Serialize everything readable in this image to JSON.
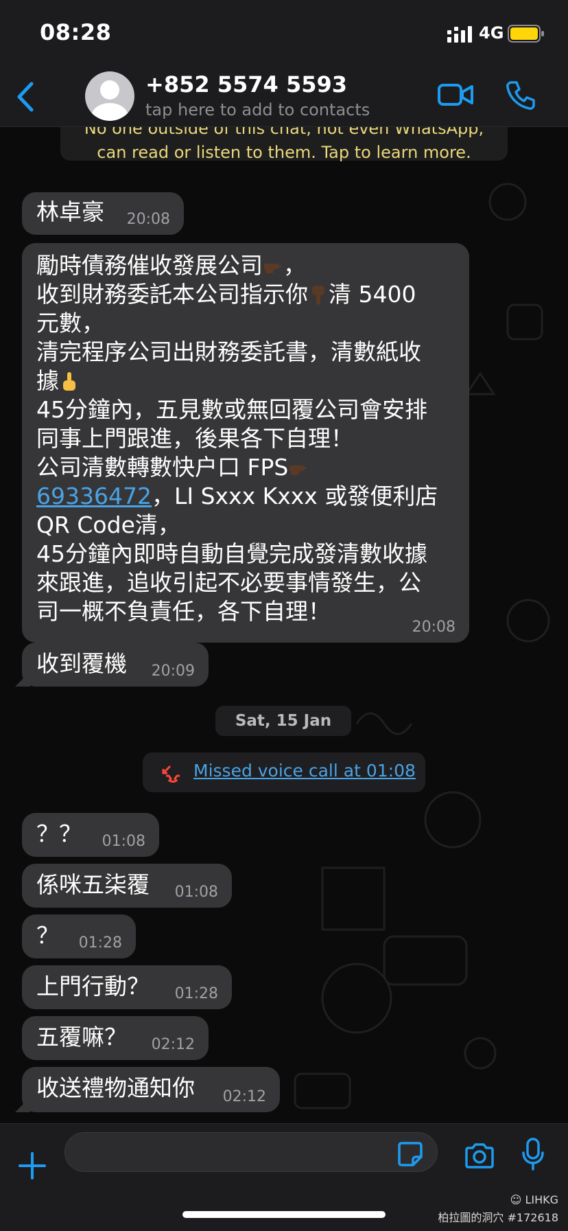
{
  "status_bar": {
    "time": "08:28",
    "network": "4G"
  },
  "header": {
    "title": "+852 5574 5593",
    "subtitle": "tap here to add to contacts"
  },
  "encryption_banner": {
    "line1": "No one outside of this chat, not even WhatsApp,",
    "line2": "can read or listen to them. Tap to learn more."
  },
  "messages": [
    {
      "text": "林卓豪",
      "time": "20:08"
    },
    {
      "lines": [
        "勵時債務催收發展公司",
        "，",
        "收到財務委託本公司指示你",
        "清 5400",
        "元數，",
        "清完程序公司出財務委託書，清數紙收",
        "據",
        "45分鐘內，五見數或無回覆公司會安排",
        "同事上門跟進，後果各下自理！",
        "公司清數轉數快户口 FPS",
        "69336472",
        "，LI Sxxx Kxxx 或發便利店",
        "QR Code清，",
        "45分鐘內即時自動自覺完成發清數收據",
        "來跟進，追收引起不必要事情發生，公",
        "司一概不負責任，各下自理！"
      ],
      "time": "20:08"
    },
    {
      "text": "收到覆機",
      "time": "20:09"
    },
    {
      "text": "？？",
      "time": "01:08"
    },
    {
      "text": "係咪五柒覆",
      "time": "01:08"
    },
    {
      "text": "？",
      "time": "01:28"
    },
    {
      "text": "上門行動？",
      "time": "01:28"
    },
    {
      "text": "五覆嘛？",
      "time": "02:12"
    },
    {
      "text": "收送禮物通知你",
      "time": "02:12"
    }
  ],
  "date_separator": "Sat, 15 Jan",
  "missed_call": "Missed voice call at 01:08",
  "input": {
    "value": "",
    "placeholder": ""
  },
  "watermark": {
    "line1": "LIHKG",
    "line2": "柏拉圖的洞穴 #172618"
  },
  "colors": {
    "link": "#4aa3e6",
    "accent": "#1d9bf0",
    "banner_text": "#ead87b",
    "bubble": "#363638"
  }
}
